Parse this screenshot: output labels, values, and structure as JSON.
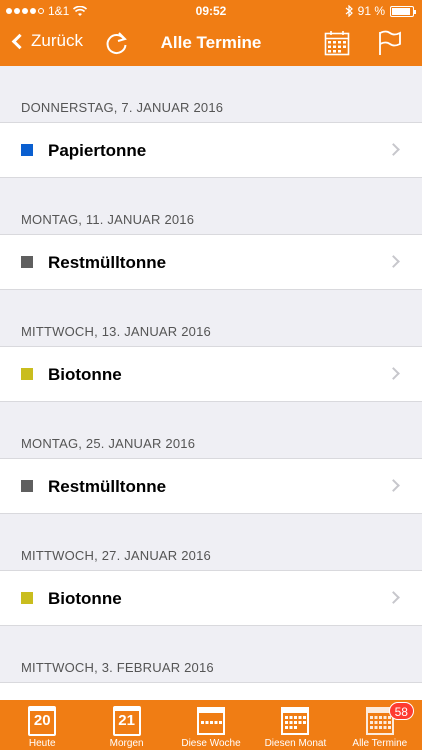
{
  "status_bar": {
    "carrier": "1&1",
    "time": "09:52",
    "battery": "91 %",
    "battery_level": 0.91
  },
  "nav": {
    "back_label": "Zurück",
    "title": "Alle Termine"
  },
  "sections": [
    {
      "date": "DONNERSTAG, 7. JANUAR 2016",
      "item": {
        "title": "Papiertonne",
        "color": "#0a5fd0"
      }
    },
    {
      "date": "MONTAG, 11. JANUAR 2016",
      "item": {
        "title": "Restmülltonne",
        "color": "#5f5f5f"
      }
    },
    {
      "date": "MITTWOCH, 13. JANUAR 2016",
      "item": {
        "title": "Biotonne",
        "color": "#c9bd1e"
      }
    },
    {
      "date": "MONTAG, 25. JANUAR 2016",
      "item": {
        "title": "Restmülltonne",
        "color": "#5f5f5f"
      }
    },
    {
      "date": "MITTWOCH, 27. JANUAR 2016",
      "item": {
        "title": "Biotonne",
        "color": "#c9bd1e"
      }
    },
    {
      "date": "MITTWOCH, 3. FEBRUAR 2016",
      "item": {
        "title": "",
        "color": ""
      }
    }
  ],
  "tabs": [
    {
      "label": "Heute",
      "day": "20",
      "icon": "calendar-day-icon"
    },
    {
      "label": "Morgen",
      "day": "21",
      "icon": "calendar-day-icon"
    },
    {
      "label": "Diese Woche",
      "icon": "calendar-week-icon"
    },
    {
      "label": "Diesen Monat",
      "icon": "calendar-month-icon"
    },
    {
      "label": "Alle Termine",
      "icon": "calendar-all-icon",
      "badge": "58"
    }
  ],
  "colors": {
    "accent": "#f07d14",
    "background": "#efeff4",
    "badge": "#ff3b30"
  }
}
